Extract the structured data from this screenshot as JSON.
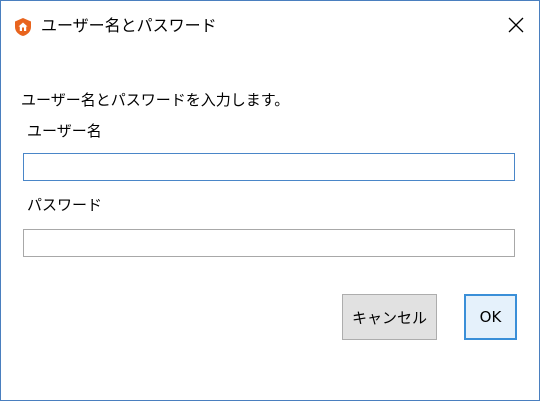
{
  "window": {
    "title": "ユーザー名とパスワード",
    "app_icon": "orange-shield-home-icon",
    "close_icon": "close-icon"
  },
  "form": {
    "instruction": "ユーザー名とパスワードを入力します。",
    "username_label": "ユーザー名",
    "username_value": "",
    "password_label": "パスワード",
    "password_value": ""
  },
  "buttons": {
    "cancel_label": "キャンセル",
    "ok_label": "OK"
  },
  "colors": {
    "accent": "#3a8fd8",
    "icon_orange": "#e8641e",
    "window_border": "#4a7fbf"
  }
}
